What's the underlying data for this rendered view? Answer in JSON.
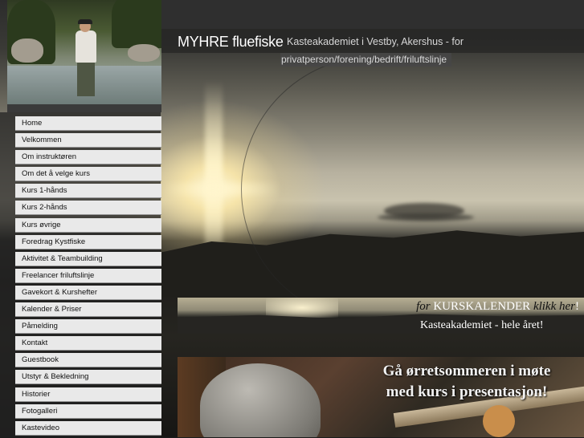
{
  "header": {
    "brand": "MYHRE fluefiske",
    "tagline_line1": "Kasteakademiet i Vestby, Akershus - for",
    "tagline_line2": "privatperson/forening/bedrift/friluftslinje"
  },
  "nav": {
    "items": [
      {
        "label": "Home"
      },
      {
        "label": "Velkommen"
      },
      {
        "label": "Om instruktøren"
      },
      {
        "label": "Om det å velge kurs"
      },
      {
        "label": "Kurs 1-hånds"
      },
      {
        "label": "Kurs 2-hånds"
      },
      {
        "label": "Kurs øvrige"
      },
      {
        "label": "Foredrag Kystfiske"
      },
      {
        "label": "Aktivitet & Teambuilding"
      },
      {
        "label": "Freelancer friluftslinje"
      },
      {
        "label": "Gavekort & Kurshefter"
      },
      {
        "label": "Kalender & Priser"
      },
      {
        "label": "Påmelding"
      },
      {
        "label": "Kontakt"
      },
      {
        "label": "Guestbook"
      },
      {
        "label": "Utstyr & Bekledning"
      },
      {
        "label": "Historier"
      },
      {
        "label": "Fotogalleri"
      },
      {
        "label": "Kastevideo"
      }
    ]
  },
  "banner": {
    "for_word": "for",
    "kurskalender": "KURSKALENDER",
    "klikk_her": "klikk her",
    "exclamation": "!",
    "subtitle": "Kasteakademiet - hele året!"
  },
  "promo": {
    "line1": "Gå ørretsommeren i møte",
    "line2": "med kurs i presentasjon!"
  },
  "colors": {
    "nav_background": "#e9e9e9",
    "nav_text": "#111111",
    "brand_text": "#ffffff",
    "tagline_text": "#d8d8d8"
  }
}
